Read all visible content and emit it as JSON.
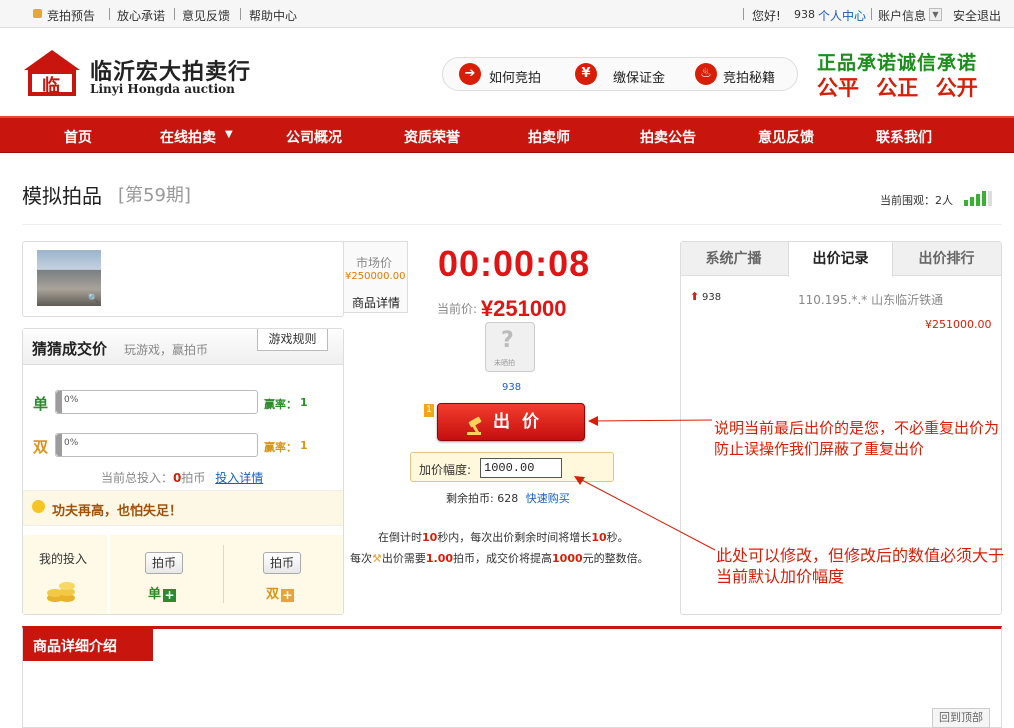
{
  "topbar": {
    "preview": "竞拍预告",
    "promise": "放心承诺",
    "feedback": "意见反馈",
    "help": "帮助中心",
    "hello": "您好!",
    "user": "938",
    "personal": "个人中心",
    "account": "账户信息",
    "logout": "安全退出"
  },
  "logo": {
    "mark": "临",
    "name_cn": "临沂宏大拍卖行",
    "name_en": "Linyi Hongda auction"
  },
  "help": {
    "how": "如何竞拍",
    "deposit": "缴保证金",
    "tips": "竞拍秘籍",
    "ico_deposit": "¥"
  },
  "slogan": {
    "line1": "正品承诺诚信承诺",
    "line2": "公平 公正 公开"
  },
  "nav": {
    "items": [
      "首页",
      "在线拍卖",
      "公司概况",
      "资质荣誉",
      "拍卖师",
      "拍卖公告",
      "意见反馈",
      "联系我们"
    ]
  },
  "page": {
    "title": "模拟拍品",
    "issue": "[第59期]",
    "viewers": "当前围观：2人"
  },
  "item": {
    "market_label": "市场价",
    "market_price": "¥250000.00",
    "detail_link": "商品详情"
  },
  "guess": {
    "title": "猜猜成交价",
    "subtitle": "玩游戏，赢拍币",
    "rules": "游戏规则",
    "odd": {
      "label": "单",
      "percent": "0%",
      "odds_label": "赢率：",
      "odds": "1",
      "fill": 0
    },
    "even": {
      "label": "双",
      "percent": "0%",
      "odds_label": "赢率：",
      "odds": "1",
      "fill": 0
    },
    "total_label": "当前总投入：",
    "total": "0",
    "total_unit": "拍币",
    "invest_detail": "投入详情",
    "motto": "功夫再高，也怕失足！",
    "my_invest": "我的投入",
    "coin": "拍币",
    "odd_short": "单",
    "even_short": "双"
  },
  "auction": {
    "timer": "00:00:08",
    "price_label": "当前价:",
    "price": "¥251000",
    "avatar_text": "未晒拍",
    "bidder": "938",
    "badge": "1",
    "bid_label": "出价",
    "inc_label": "加价幅度:",
    "inc_value": "1000.00",
    "remaining_label": "剩余拍币: 628",
    "quick_buy": "快速购买",
    "rule1_pre": "在倒计时",
    "rule1_n1": "10",
    "rule1_mid": "秒内，每次出价剩余时间将增长",
    "rule1_n2": "10",
    "rule1_post": "秒。",
    "rule2_pre": "每次",
    "rule2_mid": "出价需要",
    "rule2_n1": "1.00",
    "rule2_mid2": "拍币，成交价将提高",
    "rule2_n2": "1000",
    "rule2_post": "元的整数倍。"
  },
  "records": {
    "tabs": [
      "系统广播",
      "出价记录",
      "出价排行"
    ],
    "rows": [
      {
        "user": "938",
        "ip_location": "110.195.*.* 山东临沂铁通",
        "price": "¥251000.00"
      }
    ]
  },
  "annotations": {
    "note1": "说明当前最后出价的是您，不必重复出价为防止误操作我们屏蔽了重复出价",
    "note2": "此处可以修改，但修改后的数值必须大于当前默认加价幅度"
  },
  "detail": {
    "title": "商品详细介绍",
    "back_top": "回到顶部"
  },
  "colors": {
    "brand_red": "#c8160f",
    "accent_green": "#1c8e1c",
    "note_red": "#d81e06"
  }
}
